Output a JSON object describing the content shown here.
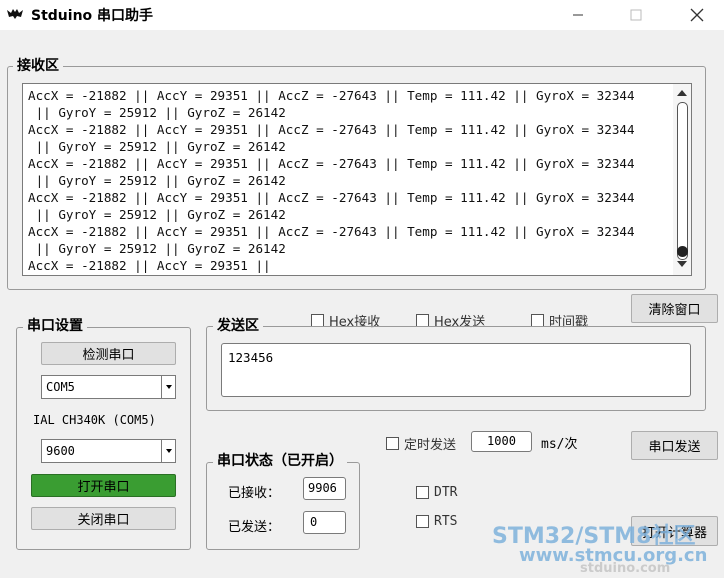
{
  "window": {
    "title": "Stduino 串口助手"
  },
  "receive": {
    "title": "接收区",
    "text": "AccX = -21882 || AccY = 29351 || AccZ = -27643 || Temp = 111.42 || GyroX = 32344\n || GyroY = 25912 || GyroZ = 26142\nAccX = -21882 || AccY = 29351 || AccZ = -27643 || Temp = 111.42 || GyroX = 32344\n || GyroY = 25912 || GyroZ = 26142\nAccX = -21882 || AccY = 29351 || AccZ = -27643 || Temp = 111.42 || GyroX = 32344\n || GyroY = 25912 || GyroZ = 26142\nAccX = -21882 || AccY = 29351 || AccZ = -27643 || Temp = 111.42 || GyroX = 32344\n || GyroY = 25912 || GyroZ = 26142\nAccX = -21882 || AccY = 29351 || AccZ = -27643 || Temp = 111.42 || GyroX = 32344\n || GyroY = 25912 || GyroZ = 26142\nAccX = -21882 || AccY = 29351 ||"
  },
  "options": {
    "hex_receive": "Hex接收",
    "hex_send": "Hex发送",
    "timestamp": "时间戳",
    "clear_window": "清除窗口"
  },
  "serial_settings": {
    "title": "串口设置",
    "detect_button": "检测串口",
    "port_value": "COM5",
    "port_description": "IAL CH340K (COM5)",
    "baud_value": "9600",
    "open_button": "打开串口",
    "close_button": "关闭串口"
  },
  "send": {
    "title": "发送区",
    "text": "123456",
    "timed_send_label": "定时发送",
    "interval_value": "1000",
    "interval_unit": "ms/次",
    "send_button": "串口发送"
  },
  "status": {
    "title": "串口状态（已开启）",
    "received_label": "已接收：",
    "received_value": "9906",
    "sent_label": "已发送：",
    "sent_value": "0",
    "dtr": "DTR",
    "rts": "RTS",
    "calculator_button": "打开计算器"
  },
  "watermark": {
    "line1": "STM32/STM8社区",
    "line2": "www.stmcu.org.cn",
    "line3": "stduino.com"
  },
  "colors": {
    "open_button_bg": "#3a9d32",
    "watermark": "#7fb2dc"
  }
}
